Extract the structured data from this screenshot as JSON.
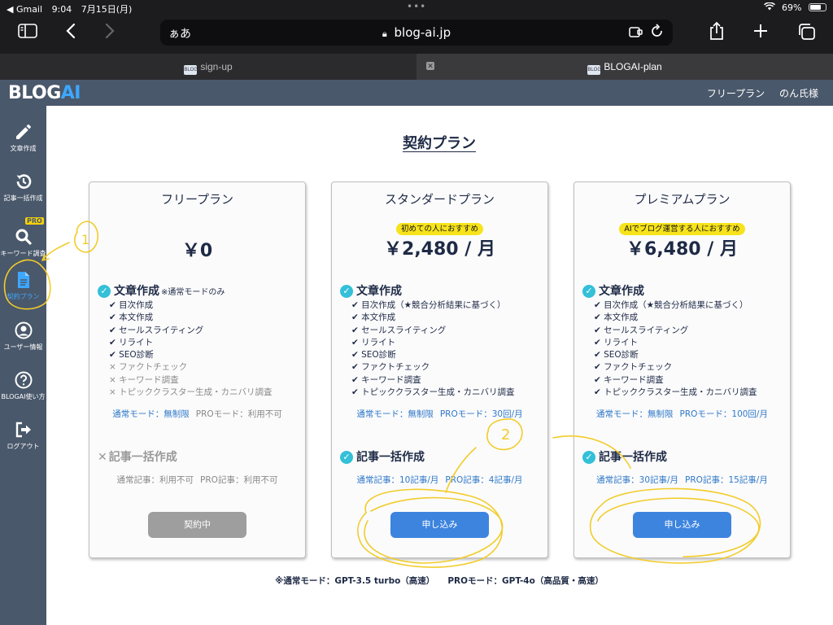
{
  "status": {
    "carrier": "◀ Gmail",
    "time": "9:04",
    "date": "7月15日(月)",
    "battery": "69%",
    "dots": "•••"
  },
  "browser": {
    "aa": "ぁあ",
    "url": "blog-ai.jp",
    "tabs": [
      {
        "label": "sign-up",
        "favicon": "BLOGAI"
      },
      {
        "label": "BLOGAI-plan",
        "favicon": "BLOGAI"
      }
    ]
  },
  "header": {
    "logo_blog": "BLOG",
    "logo_ai": "AI",
    "plan": "フリープラン",
    "user": "のん氏様"
  },
  "sidebar": {
    "pro_badge": "PRO",
    "items": [
      {
        "label": "文章作成",
        "icon": "pencil-icon"
      },
      {
        "label": "記事一括作成",
        "icon": "history-icon"
      },
      {
        "label": "キーワード調査",
        "icon": "search-icon"
      },
      {
        "label": "契約プラン",
        "icon": "document-icon"
      },
      {
        "label": "ユーザー情報",
        "icon": "user-icon"
      },
      {
        "label": "BLOGAI使い方",
        "icon": "help-icon"
      },
      {
        "label": "ログアウト",
        "icon": "logout-icon"
      }
    ]
  },
  "main": {
    "title": "契約プラン",
    "footer": {
      "normal": "※通常モード：GPT-3.5 turbo（高速）",
      "pro": "PROモード：GPT-4o（高品質・高速）"
    }
  },
  "plans": [
    {
      "name": "フリープラン",
      "badge": "",
      "price": "￥0",
      "writing_title": "文章作成",
      "writing_note": "※通常モードのみ",
      "features_on": [
        "✔ 目次作成",
        "✔ 本文作成",
        "✔ セールスライティング",
        "✔ リライト",
        "✔ SEO診断"
      ],
      "features_off": [
        "× ファクトチェック",
        "× キーワード調査",
        "× トピッククラスター生成・カニバリ調査"
      ],
      "mode_normal": "通常モード：無制限",
      "mode_pro": "PROモード：利用不可",
      "bulk_title": "記事一括作成",
      "bulk_normal": "通常記事：利用不可",
      "bulk_pro": "PRO記事：利用不可",
      "button": "契約中"
    },
    {
      "name": "スタンダードプラン",
      "badge": "初めての人におすすめ",
      "price": "￥2,480 / 月",
      "writing_title": "文章作成",
      "writing_note": "",
      "features_on": [
        "✔ 目次作成（★競合分析結果に基づく）",
        "✔ 本文作成",
        "✔ セールスライティング",
        "✔ リライト",
        "✔ SEO診断",
        "✔ ファクトチェック",
        "✔ キーワード調査",
        "✔ トピッククラスター生成・カニバリ調査"
      ],
      "features_off": [],
      "mode_normal": "通常モード：無制限",
      "mode_pro": "PROモード：30回/月",
      "bulk_title": "記事一括作成",
      "bulk_normal": "通常記事：10記事/月",
      "bulk_pro": "PRO記事：4記事/月",
      "button": "申し込み"
    },
    {
      "name": "プレミアムプラン",
      "badge": "AIでブログ運営する人におすすめ",
      "price": "￥6,480 / 月",
      "writing_title": "文章作成",
      "writing_note": "",
      "features_on": [
        "✔ 目次作成（★競合分析結果に基づく）",
        "✔ 本文作成",
        "✔ セールスライティング",
        "✔ リライト",
        "✔ SEO診断",
        "✔ ファクトチェック",
        "✔ キーワード調査",
        "✔ トピッククラスター生成・カニバリ調査"
      ],
      "features_off": [],
      "mode_normal": "通常モード：無制限",
      "mode_pro": "PROモード：100回/月",
      "bulk_title": "記事一括作成",
      "bulk_normal": "通常記事：30記事/月",
      "bulk_pro": "PRO記事：15記事/月",
      "button": "申し込み"
    }
  ],
  "annotations": {
    "mark1": "1",
    "mark2": "2",
    "color": "#f2cc2b"
  }
}
